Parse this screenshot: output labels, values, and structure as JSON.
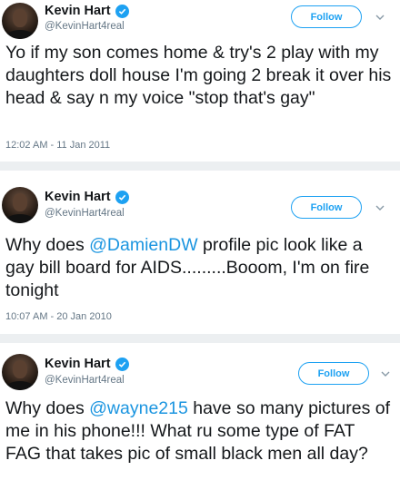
{
  "tweets": [
    {
      "name": "Kevin Hart",
      "handle": "@KevinHart4real",
      "follow_label": "Follow",
      "body": {
        "before": "Yo if my son comes home & try's 2 play with my daughters doll house I'm going 2 break it over his head & say n my voice \"stop that's gay\"",
        "mention": "",
        "after": ""
      },
      "timestamp": "12:02 AM - 11 Jan 2011"
    },
    {
      "name": "Kevin Hart",
      "handle": "@KevinHart4real",
      "follow_label": "Follow",
      "body": {
        "before": "Why does ",
        "mention": "@DamienDW",
        "after": " profile pic look like a gay bill board for AIDS.........Booom, I'm on fire tonight"
      },
      "timestamp": "10:07 AM - 20 Jan 2010"
    },
    {
      "name": "Kevin Hart",
      "handle": "@KevinHart4real",
      "follow_label": "Follow",
      "body": {
        "before": "Why does ",
        "mention": "@wayne215",
        "after": " have so many pictures of me in his phone!!! What ru some type of FAT FAG that takes pic of small black men all day?"
      },
      "timestamp": ""
    }
  ],
  "icons": {
    "avatar": "profile-photo",
    "verified": "verified-badge-icon",
    "caret": "chevron-down-icon"
  },
  "colors": {
    "twitter_blue": "#1da1f2",
    "mention_blue": "#1b95e0",
    "text": "#14171a",
    "muted": "#657786",
    "separator": "#eceff1"
  }
}
